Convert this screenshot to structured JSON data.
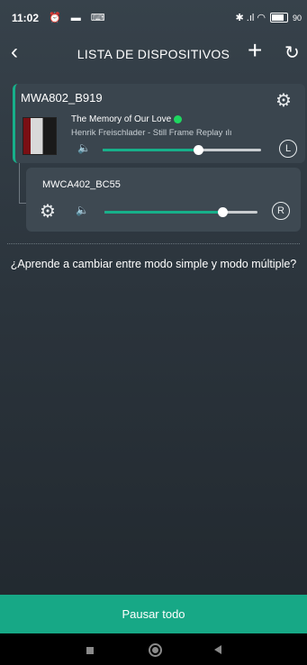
{
  "status_bar": {
    "time": "11:02",
    "left_icons": "⏰ ▬ ⌨",
    "right_icons": "✱ .ıl ◠",
    "battery": "90"
  },
  "header": {
    "back_icon": "chevron-left-icon",
    "title": "LISTA DE DISPOSITIVOS",
    "add_icon": "plus-icon",
    "refresh_icon": "refresh-icon"
  },
  "devices": [
    {
      "name": "MWA802_B919",
      "track_title": "The Memory of Our Love",
      "track_artist": "Henrik Freischlader - Still Frame Replay",
      "source_icon": "spotify-icon",
      "volume": 0.6,
      "channel": "L"
    },
    {
      "name": "MWCA402_BC55",
      "volume": 0.77,
      "channel": "R"
    }
  ],
  "help_text": "¿Aprende a cambiar entre modo simple y modo múltiple?",
  "pause_all_label": "Pausar todo",
  "colors": {
    "accent": "#17b08a",
    "background": "#2b343c"
  }
}
